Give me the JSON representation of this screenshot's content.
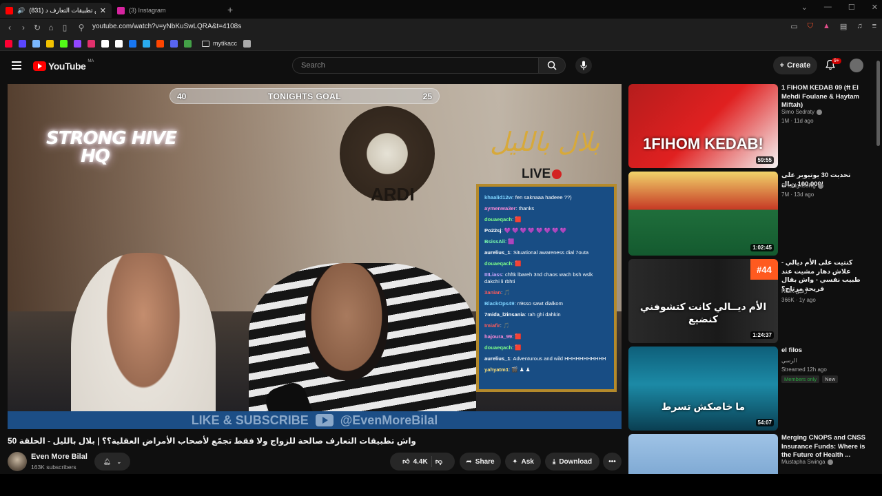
{
  "browser": {
    "tabs": [
      {
        "title": "(831) واش تطبيقات التعارف د...",
        "favicon_color": "#ff0000",
        "active": true
      },
      {
        "title": "(3) Instagram",
        "favicon_color": "#d6249f",
        "active": false
      }
    ],
    "url": "youtube.com/watch?v=yNbKuSwLQRA&t=4108s",
    "bookmark_folder": "mytikacc",
    "bookmark_colors": [
      "#ff0033",
      "#5a46ff",
      "#7ab8ff",
      "#f2c200",
      "#53fc18",
      "#9146ff",
      "#e1306c",
      "#ffffff",
      "#ffffff",
      "#1877f2",
      "#2aabee",
      "#ff4500",
      "#5865f2",
      "#43a047",
      "#aaaaaa",
      "#22c55e",
      "#5865f2",
      "#cccccc"
    ]
  },
  "youtube": {
    "logo_text": "YouTube",
    "country_code": "MA",
    "search_placeholder": "Search",
    "create_label": "Create",
    "notifications_badge": "9+"
  },
  "video": {
    "goal_left": "40",
    "goal_label": "TONIGHTS GOAL",
    "goal_right": "25",
    "neon_sign_line1": "STRONG HIVE",
    "neon_sign_line2": "HQ",
    "arabic_sign": "بلال بالليل",
    "live_label": "LIVE",
    "ram_text": "ARDI",
    "banner_left": "LIKE & SUBSCRIBE",
    "banner_right": "@EvenMoreBilal",
    "chat": [
      {
        "user": "khaalid12w",
        "color": "#7fd4ff",
        "msg": "fen saknaaa hadeee ??)"
      },
      {
        "user": "aymenwa3er",
        "color": "#ff8ad8",
        "msg": "thanks"
      },
      {
        "user": "douaeqach",
        "color": "#7cff8a",
        "msg": "🟥"
      },
      {
        "user": "Po22sj",
        "color": "#ffffff",
        "msg": "💜 💜 💜 💜 💜 💜 💜 💜"
      },
      {
        "user": "BsissAli",
        "color": "#7cffb0",
        "msg": "🟪"
      },
      {
        "user": "aurelius_1",
        "color": "#ffffff",
        "msg": "Situational awareness dial 7outa"
      },
      {
        "user": "douaeqach",
        "color": "#7cff8a",
        "msg": "🟥"
      },
      {
        "user": "IIILiass",
        "color": "#c9a6ff",
        "msg": "chftk lbareh 3nd chaos wach bsh wslk dakchi li rbhti"
      },
      {
        "user": "3anian",
        "color": "#ff5a5a",
        "msg": "🎵"
      },
      {
        "user": "BlackOps49",
        "color": "#7fd4ff",
        "msg": "n9sso sawt dialkom"
      },
      {
        "user": "7mida_l2insania",
        "color": "#ffffff",
        "msg": "rah ghi dahkin"
      },
      {
        "user": "Imiafir",
        "color": "#ff5a5a",
        "msg": "🎵"
      },
      {
        "user": "hajoura_99",
        "color": "#ff8ad8",
        "msg": "🟥"
      },
      {
        "user": "douaeqach",
        "color": "#7cff8a",
        "msg": "🟥"
      },
      {
        "user": "aurelius_1",
        "color": "#ffffff",
        "msg": "Adventurous and wild HHHHHHHHHHH"
      },
      {
        "user": "yahyatm1",
        "color": "#ffe27a",
        "msg": "🎬 ♟ ♟"
      }
    ],
    "title": "واش تطبيقات التعارف صالحة للزواج ولا فقط تجمّع لأصحاب الأمراض العقلية؟؟ | بلال بالليل - الحلقة 50",
    "channel": "Even More Bilal",
    "subscribers": "163K subscribers",
    "likes": "4.4K",
    "share_label": "Share",
    "ask_label": "Ask",
    "download_label": "Download"
  },
  "recommendations": [
    {
      "title": "1 FIHOM KEDAB 09 (ft El Mehdi Foulane & Haytam Miftah)",
      "channel": "Simo Sedraty",
      "meta": "1M  ·  11d ago",
      "duration": "59:55",
      "thumb_text": "1FIHOM KEDAB!",
      "thumb_bg": "linear-gradient(135deg,#b51d1d 0%,#e02020 50%,#f4f4f4 100%)"
    },
    {
      "title": "تحديت 30 يوتيوبر على 100,000 ريال!",
      "channel": "SHoNgxBoNg",
      "meta": "7M  ·  13d ago",
      "duration": "1:02:45",
      "thumb_text": "",
      "thumb_bg": "linear-gradient(180deg,#f1d36a 0%,#c63a25 45%,#1f6e3b 46%,#145a2f 100%)"
    },
    {
      "title": "كنتيت على الأم ديالي - علاش دهار مشيت عند طبيب نفسي - واش بقال فريحة مرتاح؟",
      "channel": "Rafik رفيق",
      "meta": "366K  ·  1y ago",
      "duration": "1:24:37",
      "thumb_text": "الأم ديــالي كانت كتشوفني كنضيع",
      "thumb_badge": "#44",
      "thumb_bg": "linear-gradient(90deg,#2a2a2a 0%,#1a1a1a 60%,#2e2e2e 100%)"
    },
    {
      "title": "el filos",
      "channel": "الرسي",
      "meta": "Streamed 12h ago",
      "duration": "54:07",
      "tag1": "Members only",
      "tag2": "New",
      "thumb_text": "ما خاصكش تسرط",
      "thumb_bg": "linear-gradient(180deg,#0e5f7a 0%,#1c8aa6 45%,#0a3f52 100%)"
    },
    {
      "title": "Merging CNOPS and CNSS Insurance Funds: Where is the Future of Health ...",
      "channel": "Mustapha Swinga",
      "meta": "",
      "duration": "",
      "thumb_text": "",
      "thumb_bg": "linear-gradient(180deg,#9fc3e6 0%,#5e8fc0 100%)"
    }
  ]
}
